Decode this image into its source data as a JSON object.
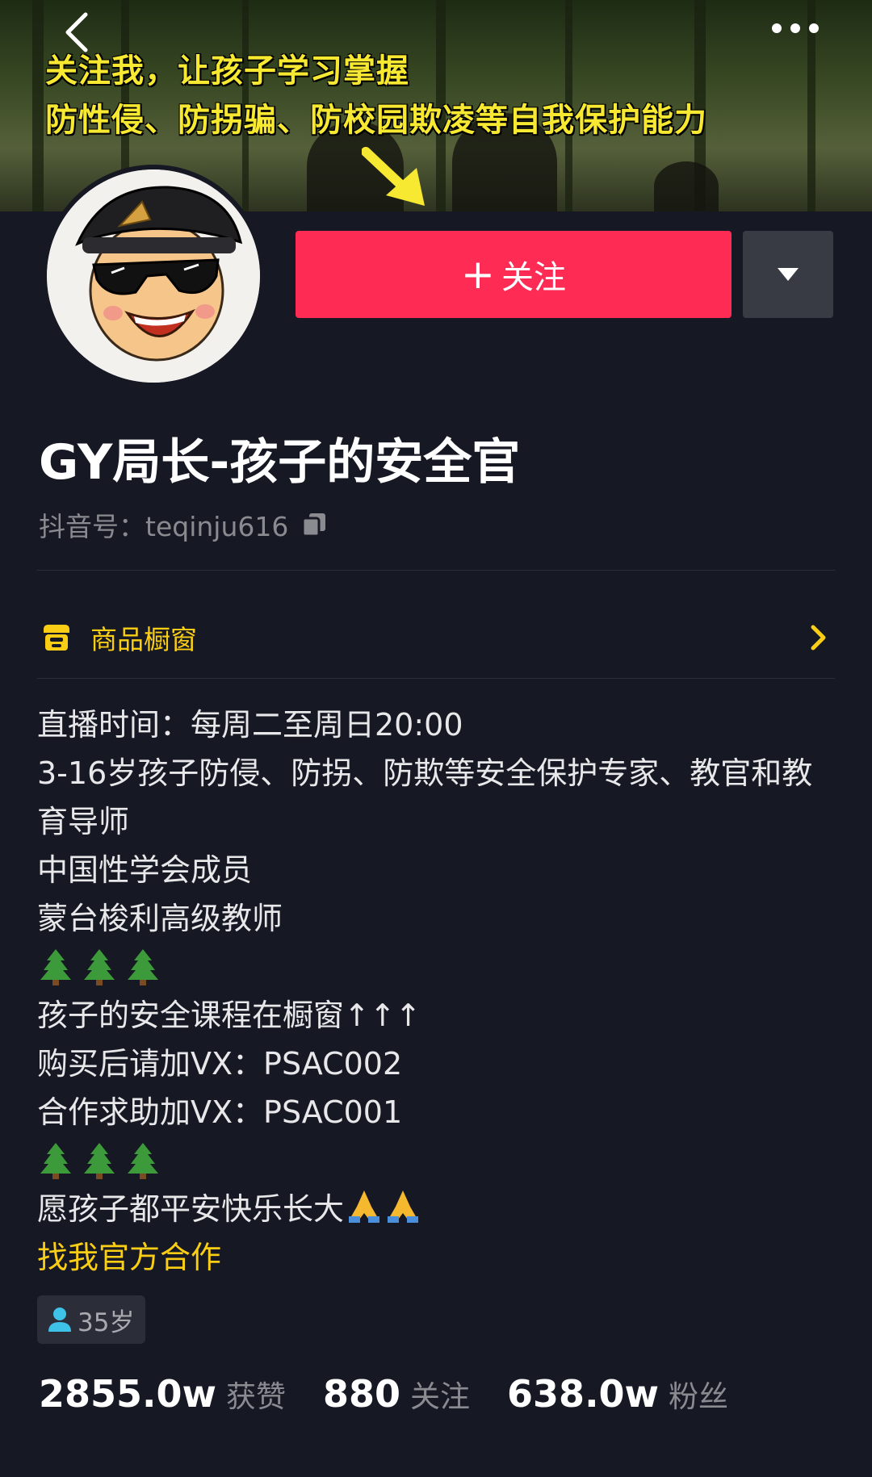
{
  "banner": {
    "line1": "关注我，让孩子学习掌握",
    "line2": "防性侵、防拐骗、防校园欺凌等自我保护能力"
  },
  "header": {
    "follow_label": "关注"
  },
  "profile": {
    "nickname": "GY局长-孩子的安全官",
    "account_id": "抖音号：teqinju616"
  },
  "shop": {
    "label": "商品橱窗"
  },
  "bio": {
    "live_time": "直播时间：每周二至周日20:00",
    "intro": "3-16岁孩子防侵、防拐、防欺等安全保护专家、教官和教育导师",
    "member": "中国性学会成员",
    "teacher": "蒙台梭利高级教师",
    "course": "孩子的安全课程在橱窗↑↑↑",
    "vx_buy": "购买后请加VX：PSAC002",
    "vx_coop": "合作求助加VX：PSAC001",
    "wish": "愿孩子都平安快乐长大",
    "official_link": "找我官方合作"
  },
  "age_tag": "35岁",
  "stats": {
    "likes_num": "2855.0w",
    "likes_label": "获赞",
    "following_num": "880",
    "following_label": "关注",
    "fans_num": "638.0w",
    "fans_label": "粉丝"
  },
  "colors": {
    "background": "#161823",
    "follow_button": "#fe2c55",
    "accent_yellow": "#face15",
    "banner_text": "#f7e832"
  }
}
